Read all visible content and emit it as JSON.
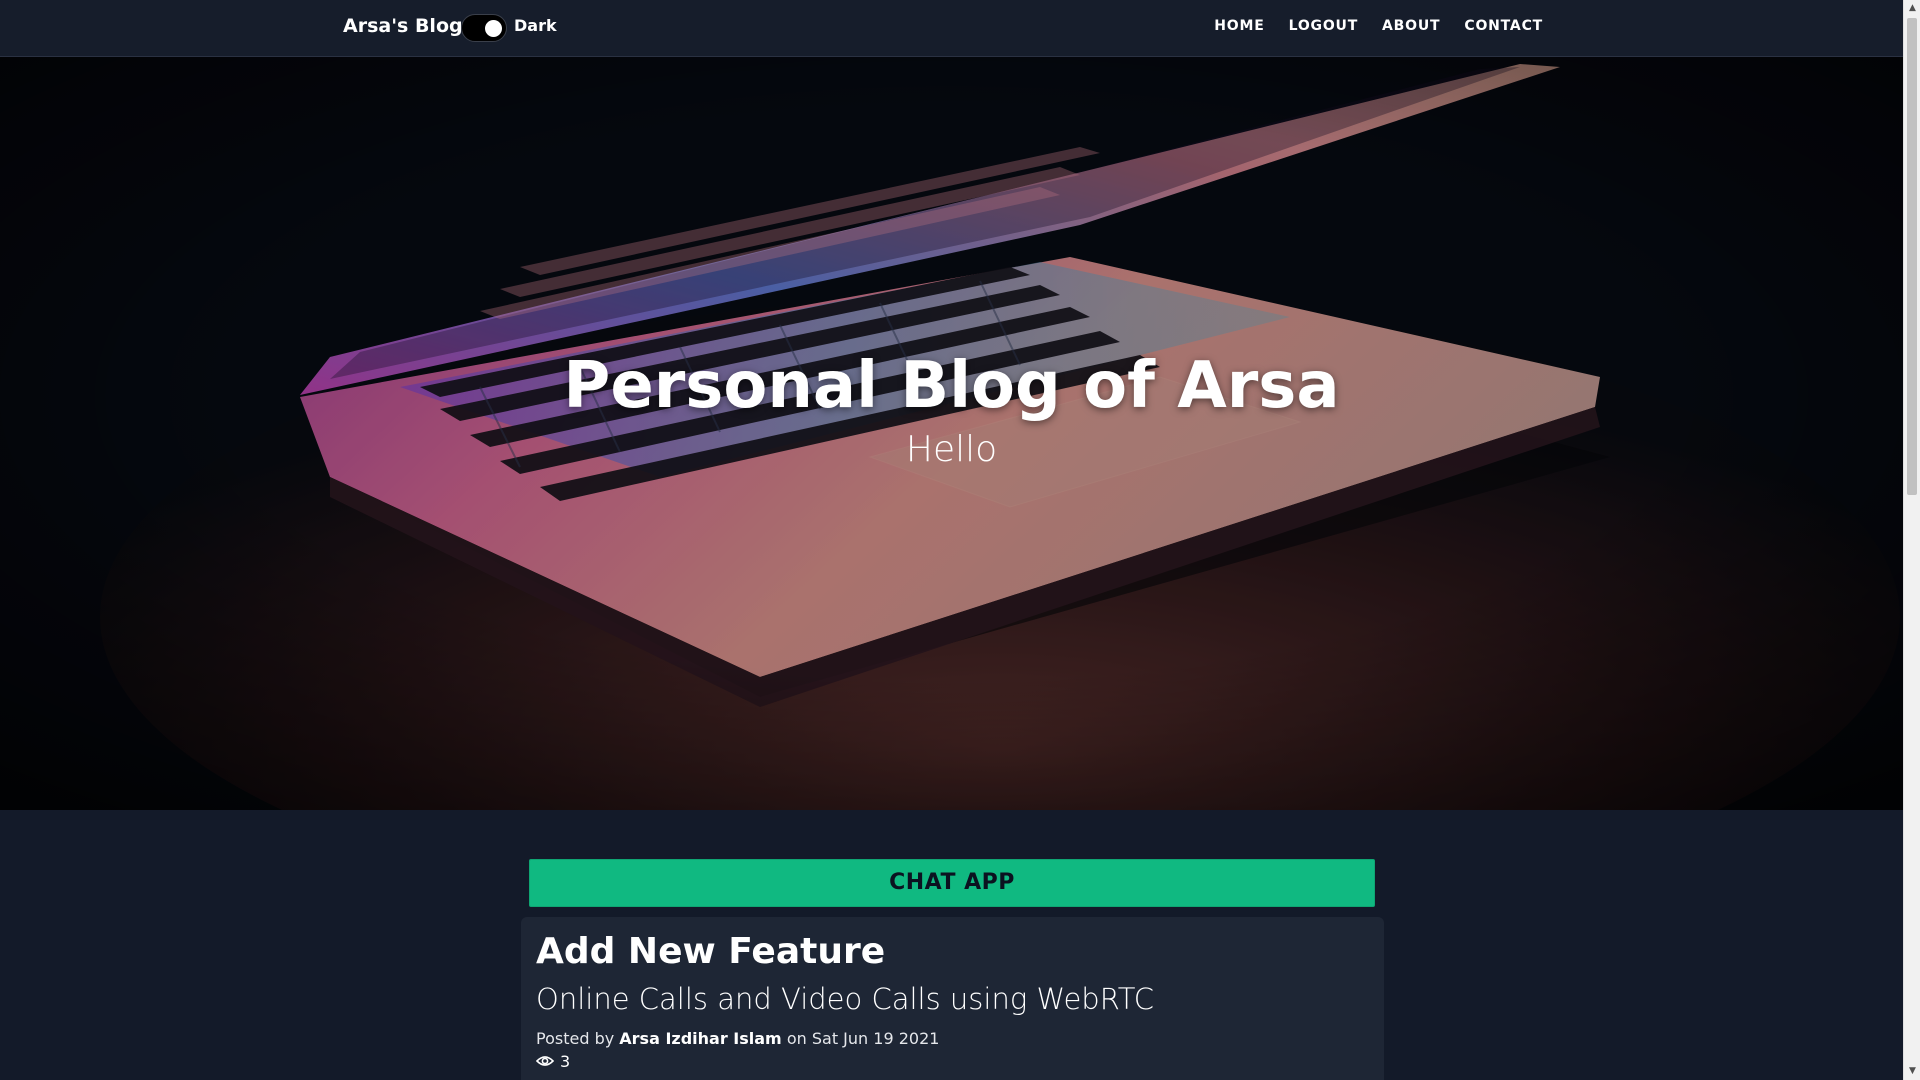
{
  "navbar": {
    "brand": "Arsa's Blog",
    "theme_toggle_label": "Dark",
    "links": [
      "HOME",
      "LOGOUT",
      "ABOUT",
      "CONTACT"
    ]
  },
  "hero": {
    "title": "Personal Blog of Arsa",
    "subtitle": "Hello"
  },
  "chat_button": "CHAT APP",
  "post": {
    "title": "Add New Feature",
    "subtitle": "Online Calls and Video Calls using WebRTC",
    "posted_by_prefix": "Posted by",
    "author": "Arsa Izdihar Islam",
    "date_prefix": "on",
    "date": "Sat Jun 19 2021",
    "views": "3"
  },
  "colors": {
    "navbar_bg": "#161d2b",
    "page_bg": "#131a29",
    "card_bg": "#1e2635",
    "accent_green": "#10b981"
  },
  "icons": {
    "views": "eye-icon",
    "toggle": "toggle-switch"
  }
}
